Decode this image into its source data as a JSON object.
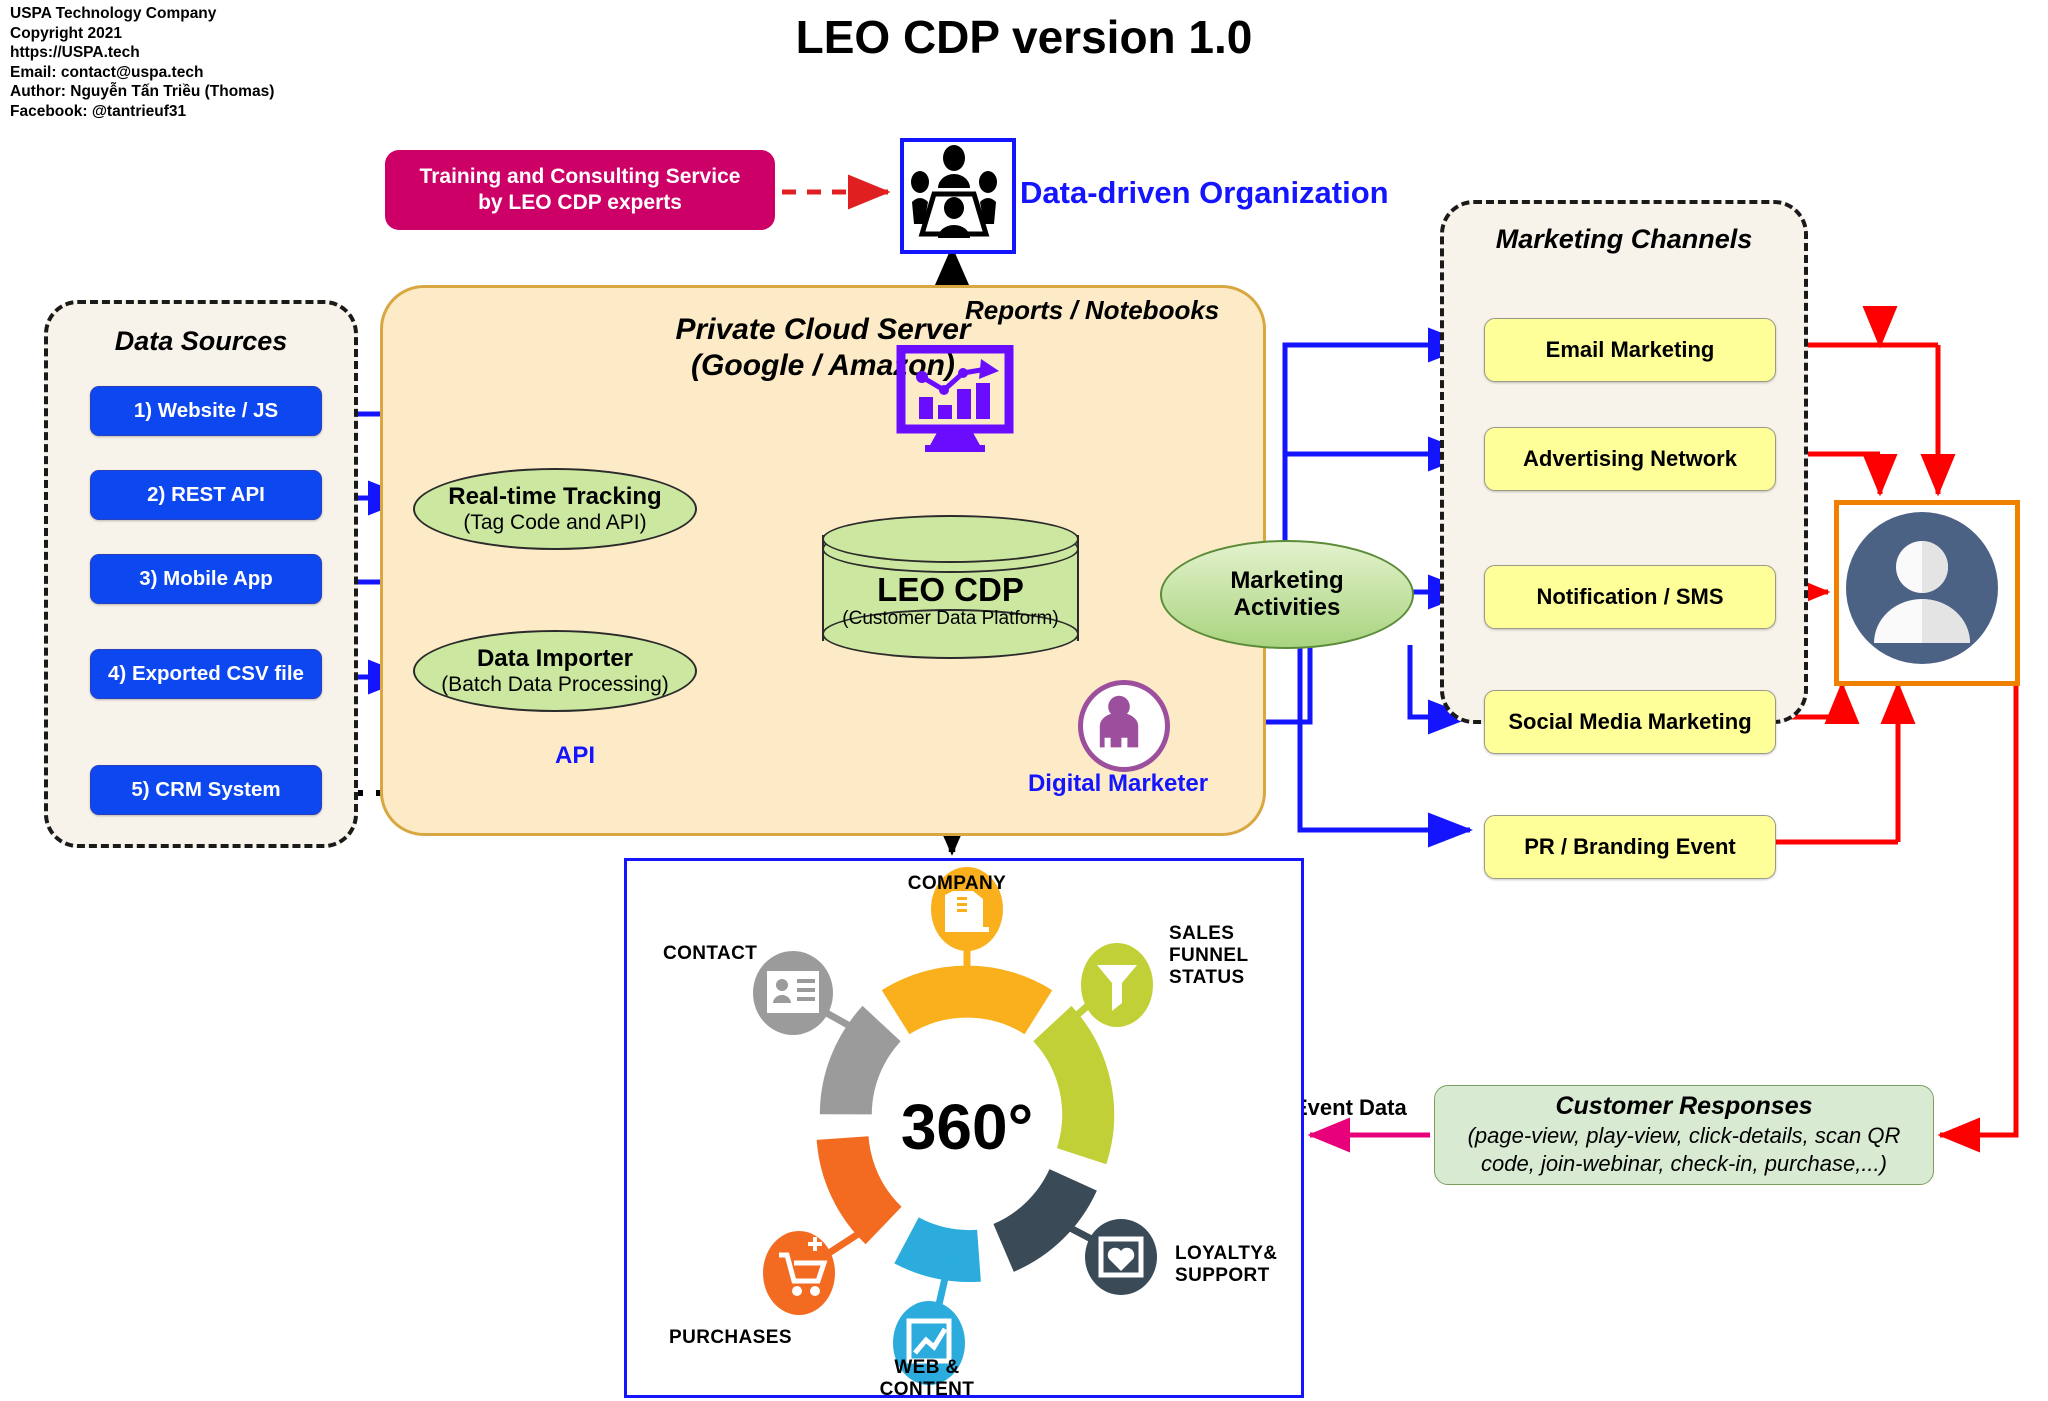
{
  "credits": {
    "lines": [
      "USPA Technology Company",
      "Copyright 2021",
      "https://USPA.tech",
      "Email: contact@uspa.tech",
      "Author: Nguyễn Tấn Triều (Thomas)",
      "Facebook: @tantrieuf31"
    ]
  },
  "title": "LEO CDP version 1.0",
  "data_sources": {
    "title": "Data Sources",
    "items": [
      {
        "label": "1) Website / JS"
      },
      {
        "label": "2) REST API"
      },
      {
        "label": "3) Mobile App"
      },
      {
        "label": "4) Exported CSV file"
      },
      {
        "label": "5) CRM System"
      }
    ]
  },
  "cloud": {
    "title_line1": "Private Cloud Server",
    "title_line2": "(Google / Amazon)",
    "realtime": {
      "main": "Real-time Tracking",
      "sub": "(Tag Code and API)"
    },
    "importer": {
      "main": "Data Importer",
      "sub": "(Batch Data Processing)"
    },
    "api_label": "API"
  },
  "leo_cdp": {
    "main": "LEO CDP",
    "sub": "(Customer Data Platform)"
  },
  "marketing_activities": {
    "line1": "Marketing",
    "line2": "Activities"
  },
  "digital_marketer": {
    "label": "Digital Marketer"
  },
  "reports": {
    "label": "Reports / Notebooks"
  },
  "organization": {
    "label": "Data-driven Organization"
  },
  "training": {
    "line1": "Training and Consulting Service",
    "line2": "by LEO CDP experts"
  },
  "channels": {
    "title": "Marketing Channels",
    "items": [
      {
        "label": "Email Marketing"
      },
      {
        "label": "Advertising Network"
      },
      {
        "label": "Notification / SMS"
      },
      {
        "label": "Social Media Marketing"
      },
      {
        "label": "PR / Branding Event"
      }
    ]
  },
  "responses": {
    "title": "Customer Responses",
    "detail_line1": "(page-view, play-view, click-details, scan QR",
    "detail_line2": "code, join-webinar, check-in, purchase,...)",
    "edge_label": "Event Data"
  },
  "chart_data": {
    "type": "pie",
    "title": "360°",
    "center_label": "360°",
    "categories": [
      "COMPANY",
      "SALES FUNNEL STATUS",
      "LOYALTY& SUPPORT",
      "WEB & CONTENT",
      "PURCHASES",
      "CONTACT"
    ],
    "values": [
      60,
      60,
      60,
      60,
      60,
      60
    ],
    "colors": [
      "#f9b01c",
      "#c2d037",
      "#3a4a57",
      "#2bacdd",
      "#f26b21",
      "#9b9b9b"
    ],
    "labels": [
      {
        "text": "COMPANY",
        "icon": "building-icon",
        "color": "#f9b01c"
      },
      {
        "text": "SALES FUNNEL STATUS",
        "icon": "funnel-icon",
        "color": "#c2d037"
      },
      {
        "text": "LOYALTY& SUPPORT",
        "icon": "loyalty-icon",
        "color": "#3a4a57"
      },
      {
        "text": "WEB & CONTENT",
        "icon": "chart-line-icon",
        "color": "#2bacdd"
      },
      {
        "text": "PURCHASES",
        "icon": "cart-plus-icon",
        "color": "#f26b21"
      },
      {
        "text": "CONTACT",
        "icon": "contact-card-icon",
        "color": "#9b9b9b"
      }
    ],
    "legend": "none",
    "grid": false
  },
  "colors": {
    "accent_blue": "#1414ff",
    "source_blue": "#0d47f0",
    "channel_yellow": "#ffff99",
    "cloud_fill": "#fdebc8",
    "cloud_border": "#d9a741",
    "panel_fill": "#f7f3ea",
    "green_node": "#cce8a0",
    "pink": "#cc0066",
    "red_flow": "#ff0000",
    "magenta_flow": "#e8007a",
    "orange_frame": "#f08000",
    "purple": "#6a0dff"
  }
}
